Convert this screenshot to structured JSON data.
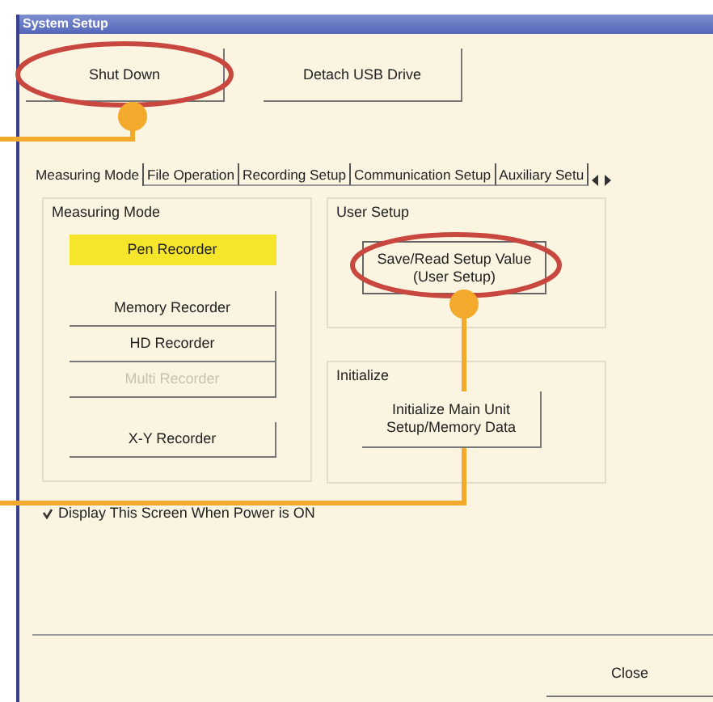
{
  "window": {
    "title": "System Setup"
  },
  "top_buttons": [
    "Shut Down",
    "Detach USB Drive"
  ],
  "tabs": [
    {
      "label": "Measuring Mode",
      "selected": true
    },
    {
      "label": "File Operation",
      "selected": false
    },
    {
      "label": "Recording Setup",
      "selected": false
    },
    {
      "label": "Communication Setup",
      "selected": false
    },
    {
      "label": "Auxiliary Setu",
      "selected": false
    }
  ],
  "measuring_mode": {
    "title": "Measuring Mode",
    "modes": [
      {
        "label": "Pen Recorder",
        "selected": true,
        "disabled": false
      },
      {
        "label": "Memory Recorder",
        "selected": false,
        "disabled": false
      },
      {
        "label": "HD Recorder",
        "selected": false,
        "disabled": false
      },
      {
        "label": "Multi Recorder",
        "selected": false,
        "disabled": true
      },
      {
        "label": "X-Y Recorder",
        "selected": false,
        "disabled": false
      }
    ]
  },
  "user_setup": {
    "title": "User Setup",
    "button": "Save/Read Setup Value\n(User Setup)"
  },
  "initialize": {
    "title": "Initialize",
    "button": "Initialize Main Unit\nSetup/Memory Data"
  },
  "startup_checkbox": {
    "label": "Display This Screen When Power is ON",
    "checked": true
  },
  "close_button": "Close"
}
